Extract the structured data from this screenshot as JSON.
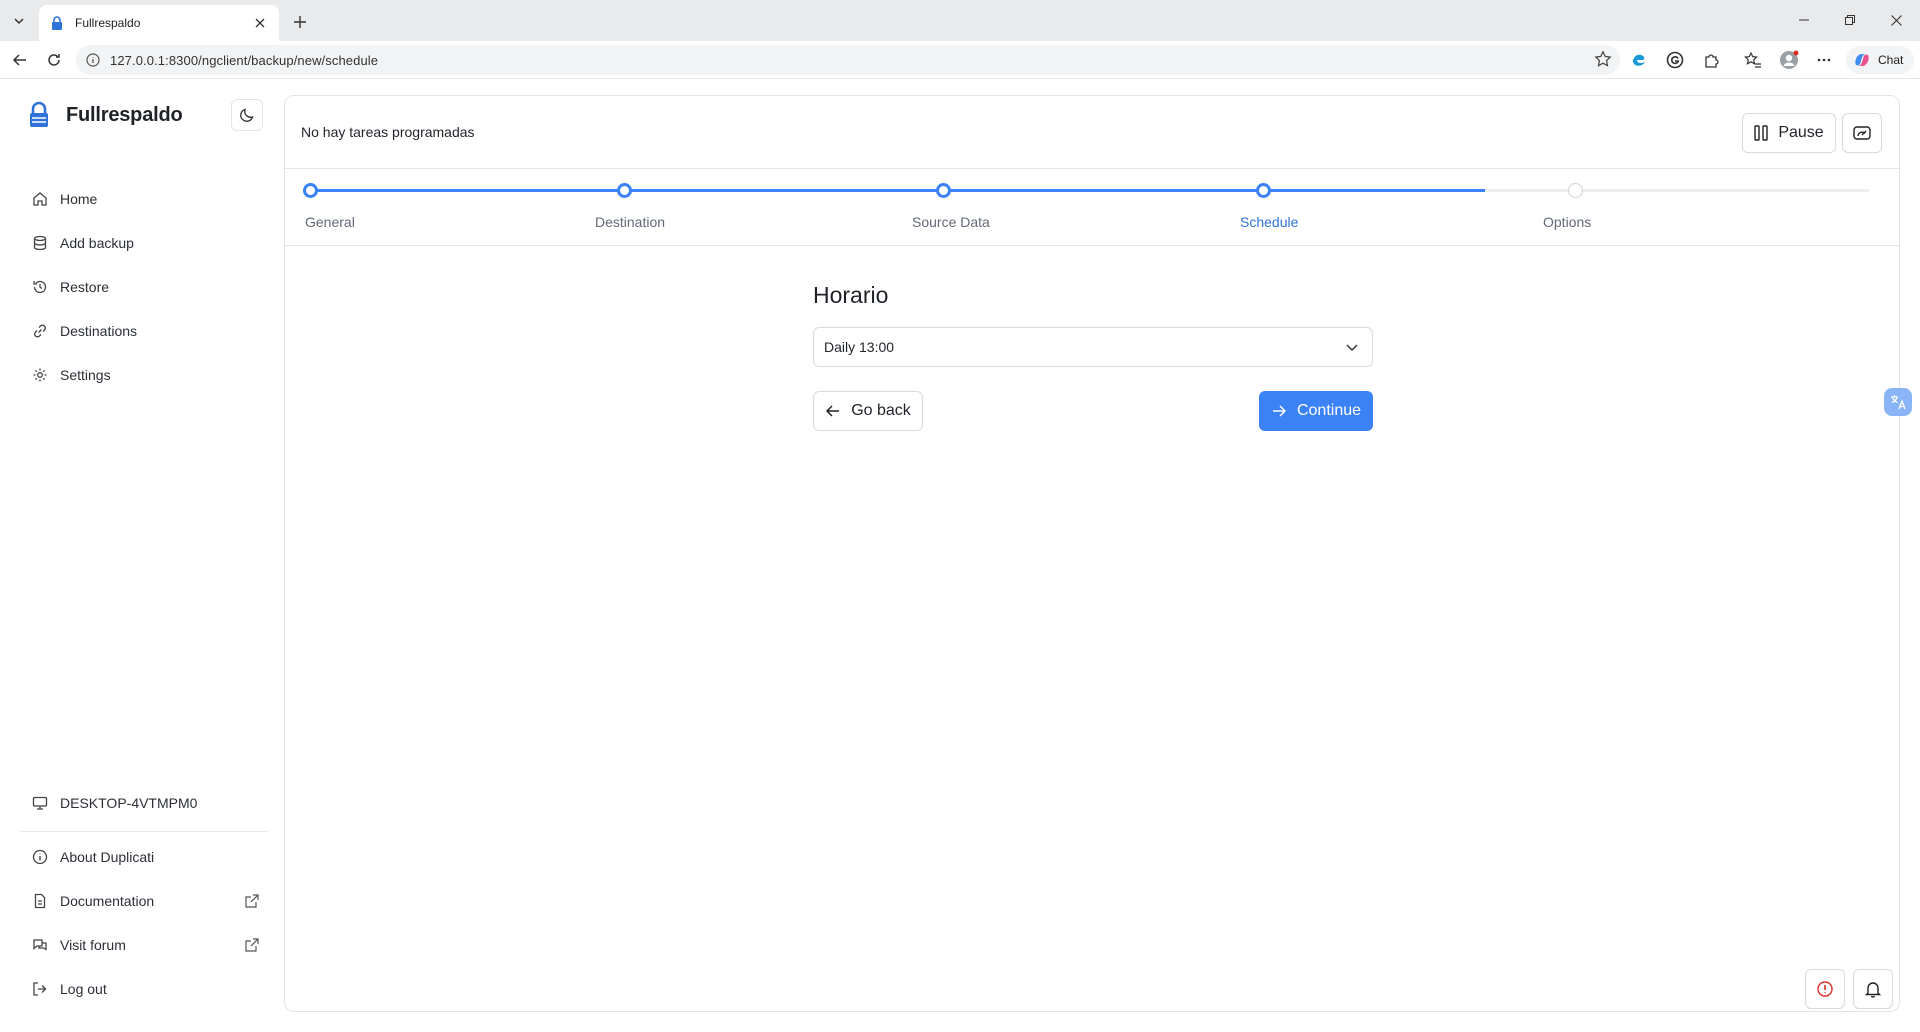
{
  "browser": {
    "tab_title": "Fullrespaldo",
    "url": "127.0.0.1:8300/ngclient/backup/new/schedule",
    "chat_label": "Chat"
  },
  "sidebar": {
    "brand_name": "Fullrespaldo",
    "nav": [
      {
        "label": "Home",
        "icon": "home-icon"
      },
      {
        "label": "Add backup",
        "icon": "database-icon"
      },
      {
        "label": "Restore",
        "icon": "history-icon"
      },
      {
        "label": "Destinations",
        "icon": "link-icon"
      },
      {
        "label": "Settings",
        "icon": "gear-icon"
      }
    ],
    "machine_name": "DESKTOP-4VTMPM0",
    "links": [
      {
        "label": "About Duplicati",
        "icon": "info-icon"
      },
      {
        "label": "Documentation",
        "icon": "document-icon"
      },
      {
        "label": "Visit forum",
        "icon": "chat-bubbles-icon"
      },
      {
        "label": "Log out",
        "icon": "logout-icon"
      }
    ]
  },
  "topbar": {
    "status_text": "No hay tareas programadas",
    "pause_label": "Pause"
  },
  "stepper": {
    "steps": [
      "General",
      "Destination",
      "Source Data",
      "Schedule",
      "Options"
    ],
    "active_index": 3
  },
  "schedule": {
    "heading": "Horario",
    "selected_value": "Daily 13:00",
    "back_label": "Go back",
    "continue_label": "Continue"
  },
  "colors": {
    "accent": "#3b82f6",
    "active_step_text": "#2f73d8",
    "border": "#e2e4e8"
  }
}
